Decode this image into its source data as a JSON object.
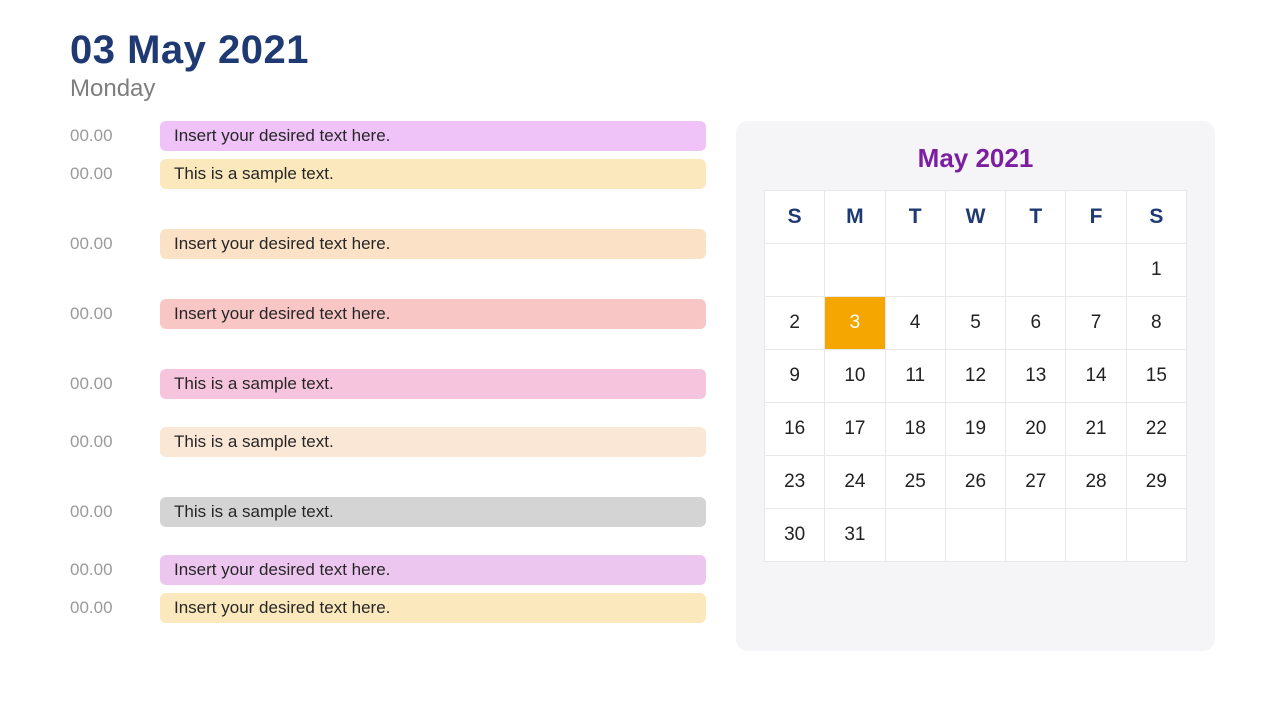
{
  "header": {
    "title": "03 May 2021",
    "subtitle": "Monday"
  },
  "schedule": [
    {
      "time": "00.00",
      "text": "Insert your desired text here.",
      "color": "c-purple",
      "gap": ""
    },
    {
      "time": "00.00",
      "text": "This is a sample text.",
      "color": "c-yellow",
      "gap": "gap-s"
    },
    {
      "time": "00.00",
      "text": "Insert your desired text here.",
      "color": "c-orange",
      "gap": "gap-l"
    },
    {
      "time": "00.00",
      "text": "Insert your desired text here.",
      "color": "c-pink",
      "gap": "gap-l"
    },
    {
      "time": "00.00",
      "text": "This is a sample text.",
      "color": "c-hotpink",
      "gap": "gap-l"
    },
    {
      "time": "00.00",
      "text": "This is a sample text.",
      "color": "c-peach",
      "gap": "gap-m"
    },
    {
      "time": "00.00",
      "text": "This is a sample text.",
      "color": "c-grey",
      "gap": "gap-l"
    },
    {
      "time": "00.00",
      "text": "Insert your desired text here.",
      "color": "c-purple2",
      "gap": "gap-m"
    },
    {
      "time": "00.00",
      "text": "Insert your desired text here.",
      "color": "c-yellow2",
      "gap": "gap-s"
    }
  ],
  "calendar": {
    "title": "May 2021",
    "dow": [
      "S",
      "M",
      "T",
      "W",
      "T",
      "F",
      "S"
    ],
    "cells": [
      "",
      "",
      "",
      "",
      "",
      "",
      "1",
      "2",
      "3",
      "4",
      "5",
      "6",
      "7",
      "8",
      "9",
      "10",
      "11",
      "12",
      "13",
      "14",
      "15",
      "16",
      "17",
      "18",
      "19",
      "20",
      "21",
      "22",
      "23",
      "24",
      "25",
      "26",
      "27",
      "28",
      "29",
      "30",
      "31",
      "",
      "",
      "",
      "",
      ""
    ],
    "highlight": "3"
  }
}
